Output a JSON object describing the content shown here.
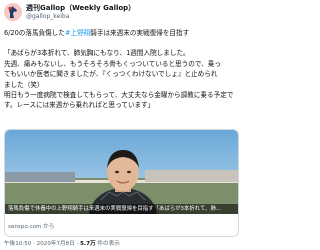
{
  "author": {
    "name": "週刊Gallop（Weekly Gallop）",
    "handle": "@gallop_keiba"
  },
  "tweet": {
    "line1_prefix": "6/20の落馬負傷した",
    "mention": "#上野翔",
    "line1_suffix": "騎手は来週末の実戦復帰を目指す",
    "quote_lines": [
      "「あばらが3本折れて、肺気胸にもなり、1週間入院しました。",
      "先週、痛みもないし、もうそろそろ骨もくっついていると思うので、乗っ",
      "てもいいか医者に聞きましたが、『くっつくわけないでしょ』と止められ",
      "ました（笑）",
      "明日もう一度病院で検査してもらって、大丈夫なら金曜から調教に乗る予定で",
      "す。レースには来週から乗れればと思っています」"
    ]
  },
  "card": {
    "caption": "落馬負傷で休養中の上野翔騎手は来週末の実戦復帰を目指す「あばらが3本折れて、肺...",
    "source": "sanspo.com から"
  },
  "meta": {
    "time_date": "午後10:50 · 2020年7月8日 · ",
    "views": "5.7万",
    "views_label": " 件の表示"
  }
}
